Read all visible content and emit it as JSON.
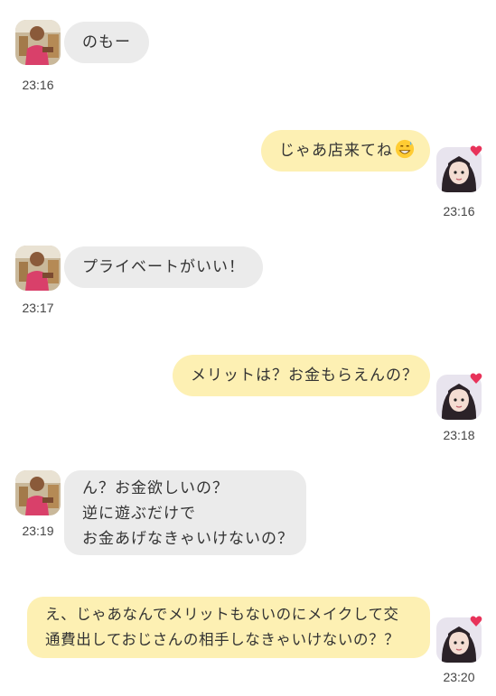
{
  "messages": [
    {
      "side": "in",
      "lines": [
        "のもー"
      ],
      "time": "23:16"
    },
    {
      "side": "out",
      "lines": [
        "じゃあ店来てね"
      ],
      "emoji": "grinning-sweat-emoji",
      "time": "23:16"
    },
    {
      "side": "in",
      "lines": [
        "プライベートがいい！"
      ],
      "time": "23:17"
    },
    {
      "side": "out",
      "lines": [
        "メリットは？お金もらえんの？"
      ],
      "time": "23:18"
    },
    {
      "side": "in",
      "lines": [
        "ん？お金欲しいの？",
        "逆に遊ぶだけで",
        "お金あげなきゃいけないの？"
      ],
      "time": "23:19"
    },
    {
      "side": "out",
      "lines": [
        "え、じゃあなんでメリットもないのにメイクして交",
        "通費出しておじさんの相手しなきゃいけないの？？"
      ],
      "time": "23:20"
    }
  ],
  "colors": {
    "incoming_bubble": "#ebebeb",
    "outgoing_bubble": "#fdf0b3",
    "heart_badge": "#e8335a"
  },
  "icons": {
    "incoming_avatar": "man-avatar",
    "outgoing_avatar": "woman-avatar",
    "badge": "heart-icon"
  }
}
